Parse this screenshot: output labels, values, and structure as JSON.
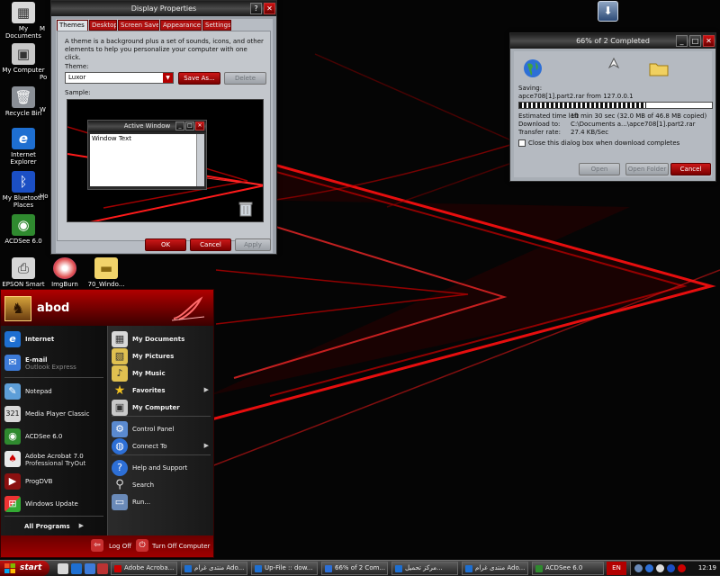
{
  "colors": {
    "accent": "#b30000",
    "background": "#050505"
  },
  "desktop": {
    "icons": [
      {
        "label": "My Documents",
        "icon": "document-icon"
      },
      {
        "label": "M",
        "icon": "document-icon"
      },
      {
        "label": "My Computer",
        "icon": "computer-icon"
      },
      {
        "label": "Po",
        "icon": "app-icon"
      },
      {
        "label": "Recycle Bin",
        "icon": "recycle-bin-icon"
      },
      {
        "label": "W",
        "icon": "app-icon"
      },
      {
        "label": "Internet Explorer",
        "icon": "ie-icon"
      },
      {
        "label": "My Bluetooth Places",
        "icon": "bluetooth-icon"
      },
      {
        "label": "Ho",
        "icon": "app-icon"
      },
      {
        "label": "ACDSee 6.0",
        "icon": "acdsee-icon"
      },
      {
        "label": "EPSON Smart Panel",
        "icon": "printer-icon"
      },
      {
        "label": "ImgBurn",
        "icon": "disc-icon"
      },
      {
        "label": "70_Windo...",
        "icon": "folder-icon"
      }
    ]
  },
  "display_properties": {
    "title": "Display Properties",
    "tabs": [
      "Themes",
      "Desktop",
      "Screen Saver",
      "Appearance",
      "Settings"
    ],
    "description": "A theme is a background plus a set of sounds, icons, and other elements to help you personalize your computer with one click.",
    "theme_label": "Theme:",
    "theme_value": "Luxor",
    "save_as": "Save As...",
    "delete": "Delete",
    "sample_label": "Sample:",
    "sample_window_title": "Active Window",
    "sample_window_text": "Window Text",
    "ok": "OK",
    "cancel": "Cancel",
    "apply": "Apply"
  },
  "download": {
    "title": "66% of 2 Completed",
    "saving_label": "Saving:",
    "file_line": "apce708[1].part2.rar from 127.0.0.1",
    "progress": 0.66,
    "time_left_label": "Estimated time left",
    "time_left": "10 min 30 sec (32.0 MB of 46.8 MB copied)",
    "download_to_label": "Download to:",
    "download_to": "C:\\Documents a...\\apce708[1].part2.rar",
    "rate_label": "Transfer rate:",
    "rate": "27.4 KB/Sec",
    "close_checkbox": "Close this dialog box when download completes",
    "open": "Open",
    "open_folder": "Open Folder",
    "cancel": "Cancel"
  },
  "start_menu": {
    "user": "abod",
    "pinned": [
      {
        "label": "Internet",
        "icon": "ie-icon"
      },
      {
        "label": "E-mail",
        "sublabel": "Outlook Express",
        "icon": "email-icon"
      }
    ],
    "recent": [
      {
        "label": "Notepad",
        "icon": "notepad-icon"
      },
      {
        "label": "Media Player Classic",
        "icon": "media-player-icon"
      },
      {
        "label": "ACDSee 6.0",
        "icon": "acdsee-icon"
      },
      {
        "label": "Adobe Acrobat 7.0",
        "sublabel": "Professional TryOut",
        "icon": "acrobat-icon"
      },
      {
        "label": "ProgDVB",
        "icon": "progdvb-icon"
      },
      {
        "label": "Windows Update",
        "icon": "windows-update-icon"
      }
    ],
    "all_programs": "All Programs",
    "right_items": [
      {
        "label": "My Documents",
        "icon": "document-icon"
      },
      {
        "label": "My Pictures",
        "icon": "pictures-icon"
      },
      {
        "label": "My Music",
        "icon": "music-icon"
      },
      {
        "label": "Favorites",
        "icon": "favorites-icon"
      },
      {
        "label": "My Computer",
        "icon": "computer-icon"
      },
      {
        "label": "Control Panel",
        "icon": "control-panel-icon"
      },
      {
        "label": "Connect To",
        "icon": "connect-icon"
      },
      {
        "label": "Help and Support",
        "icon": "help-icon"
      },
      {
        "label": "Search",
        "icon": "search-icon"
      },
      {
        "label": "Run...",
        "icon": "run-icon"
      }
    ],
    "log_off": "Log Off",
    "turn_off": "Turn Off Computer"
  },
  "taskbar": {
    "start": "start",
    "tasks": [
      "Adobe Acroba...",
      "منتدى غرام Ado...",
      "Up-File :: dow...",
      "66% of 2 Com...",
      "مركز تحميل...",
      "منتدى غرام Ado...",
      "ACDSee 6.0"
    ],
    "language": "EN",
    "clock": "12:19"
  }
}
